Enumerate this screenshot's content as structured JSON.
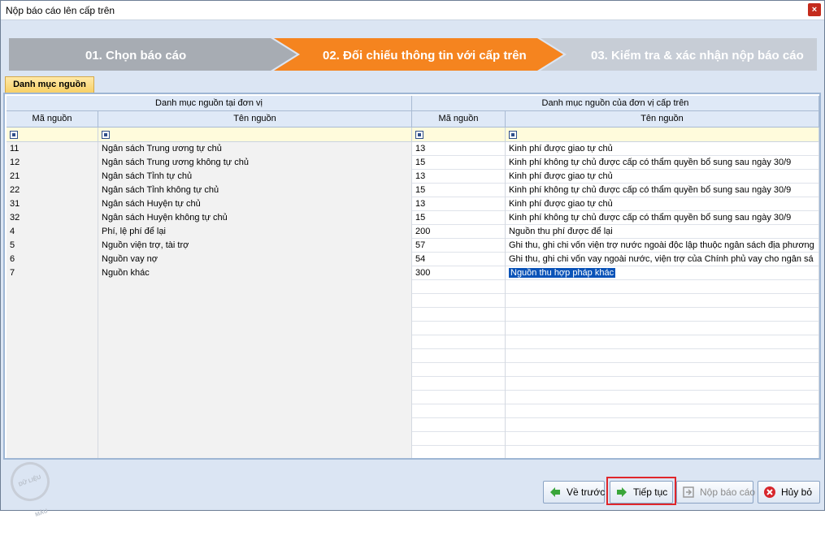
{
  "window": {
    "title": "Nộp báo cáo lên cấp trên",
    "close_label": "×"
  },
  "wizard": {
    "steps": [
      {
        "label": "01. Chọn báo cáo",
        "state": "done"
      },
      {
        "label": "02. Đối chiếu thông tin với cấp trên",
        "state": "active"
      },
      {
        "label": "03. Kiểm tra & xác nhận nộp báo cáo",
        "state": "pending"
      }
    ],
    "colors": {
      "done": "#a7acb3",
      "active": "#f5841f",
      "pending": "#c7cdd6"
    }
  },
  "tab": {
    "label": "Danh mục nguồn"
  },
  "grid": {
    "group_left": "Danh mục nguồn tại đơn vị",
    "group_right": "Danh mục nguồn của đơn vị cấp trên",
    "columns": [
      "Mã nguồn",
      "Tên nguồn",
      "Mã nguồn",
      "Tên nguồn"
    ],
    "rows": [
      [
        "11",
        "Ngân sách Trung ương tự chủ",
        "13",
        "Kinh phí được giao tự chủ"
      ],
      [
        "12",
        "Ngân sách Trung ương không tự chủ",
        "15",
        "Kinh phí không tự chủ được cấp có thẩm quyền bổ sung sau ngày 30/9"
      ],
      [
        "21",
        "Ngân sách Tỉnh tự chủ",
        "13",
        "Kinh phí được giao tự chủ"
      ],
      [
        "22",
        "Ngân sách Tỉnh không tự chủ",
        "15",
        "Kinh phí không tự chủ được cấp có thẩm quyền bổ sung sau ngày 30/9"
      ],
      [
        "31",
        "Ngân sách Huyện tự chủ",
        "13",
        "Kinh phí được giao tự chủ"
      ],
      [
        "32",
        "Ngân sách Huyện không tự chủ",
        "15",
        "Kinh phí không tự chủ được cấp có thẩm quyền bổ sung sau ngày 30/9"
      ],
      [
        "4",
        "Phí, lệ phí để lại",
        "200",
        "Nguồn thu phí được để lại"
      ],
      [
        "5",
        "Nguồn viện trợ, tài trợ",
        "57",
        "Ghi thu, ghi chi vốn viện trợ nước ngoài độc lập thuộc ngân sách địa phương"
      ],
      [
        "6",
        "Nguồn vay nợ",
        "54",
        "Ghi thu, ghi chi vốn vay ngoài nước, viện trợ của Chính phủ vay cho ngân sá"
      ],
      [
        "7",
        "Nguồn khác",
        "300",
        "Nguồn thu hợp pháp khác"
      ]
    ],
    "selected_row": 9
  },
  "stamp": {
    "text": "DỮ LIỆU MẪU"
  },
  "buttons": {
    "back": "Về trước",
    "next": "Tiếp tục",
    "submit": "Nộp báo cáo",
    "cancel": "Hủy bỏ"
  }
}
